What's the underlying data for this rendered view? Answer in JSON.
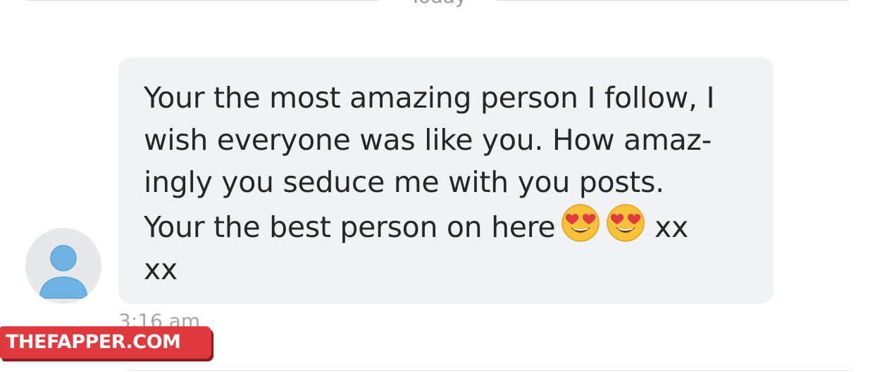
{
  "header": {
    "date_label": "Today"
  },
  "message": {
    "lines": [
      "Your the most amazing person I follow, I",
      "wish everyone was like you. How amaz-",
      "ingly you seduce me with you posts.",
      "Your the best person on here",
      "xx"
    ],
    "line4_suffix": "xx",
    "emojis": [
      "heart-eyes-emoji",
      "heart-eyes-emoji"
    ],
    "timestamp": "3:16 am"
  },
  "avatar": {
    "icon": "default-user-icon",
    "colors": {
      "background": "#e7e8ea",
      "figure": "#6fb3e4"
    }
  },
  "watermark": {
    "text": "THEFAPPER.COM",
    "color": "#e0393e"
  },
  "colors": {
    "bubble": "#f1f2f3",
    "text": "#262626",
    "meta": "#a6a6a6"
  }
}
